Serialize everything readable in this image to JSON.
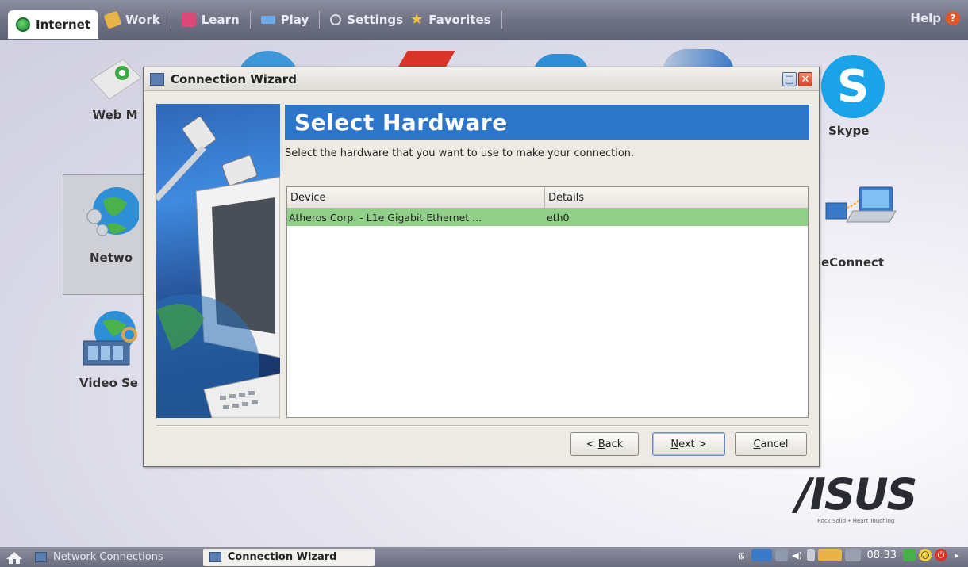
{
  "topbar": {
    "tabs": [
      {
        "label": "Internet",
        "icon": "globe-icon",
        "active": true
      },
      {
        "label": "Work",
        "icon": "work-icon"
      },
      {
        "label": "Learn",
        "icon": "learn-icon"
      },
      {
        "label": "Play",
        "icon": "play-icon"
      },
      {
        "label": "Settings",
        "icon": "settings-icon"
      },
      {
        "label": "Favorites",
        "icon": "star-icon"
      }
    ],
    "help_label": "Help"
  },
  "desktop": {
    "icons": [
      {
        "label": "Web M",
        "icon": "web-mail-icon"
      },
      {
        "label": "Netwo",
        "icon": "network-icon",
        "selected": true
      },
      {
        "label": "Video Se",
        "icon": "video-search-icon"
      },
      {
        "label": "Skype",
        "icon": "skype-icon"
      },
      {
        "label": "eConnect",
        "icon": "econnect-icon"
      }
    ],
    "brand": {
      "logo": "/ISUS",
      "tagline": "Rock Solid • Heart Touching"
    }
  },
  "dialog": {
    "title": "Connection Wizard",
    "banner": "Select Hardware",
    "subtitle": "Select the hardware that you want to use to make your connection.",
    "table": {
      "columns": [
        "Device",
        "Details"
      ],
      "rows": [
        {
          "device": "Atheros Corp. - L1e Gigabit Ethernet ...",
          "details": "eth0",
          "selected": true
        }
      ]
    },
    "buttons": {
      "back": {
        "prefix": "< ",
        "mnemonic": "B",
        "rest": "ack"
      },
      "next": {
        "mnemonic": "N",
        "rest": "ext >"
      },
      "cancel": {
        "mnemonic": "C",
        "rest": "ancel"
      }
    }
  },
  "taskbar": {
    "tasks": [
      {
        "label": "Network Connections"
      },
      {
        "label": "Connection Wizard",
        "active": true
      }
    ],
    "clock": "08:33"
  },
  "colors": {
    "banner": "#2d75c9",
    "selected_row": "#8fcf88",
    "bar": "#6e7183"
  }
}
